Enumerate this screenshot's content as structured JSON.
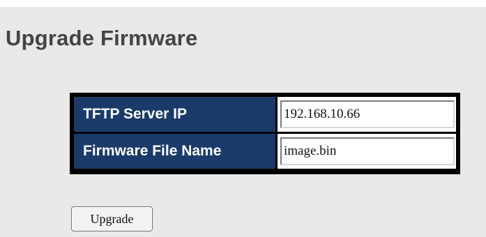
{
  "page": {
    "title": "Upgrade Firmware"
  },
  "form": {
    "rows": [
      {
        "label": "TFTP Server IP",
        "value": "192.168.10.66"
      },
      {
        "label": "Firmware File Name",
        "value": "image.bin"
      }
    ]
  },
  "actions": {
    "upgrade_label": "Upgrade"
  },
  "colors": {
    "page_background": "#e9e9e9",
    "label_cell_background": "#1a3b6a",
    "label_text": "#ffffff",
    "title_text": "#444444"
  }
}
